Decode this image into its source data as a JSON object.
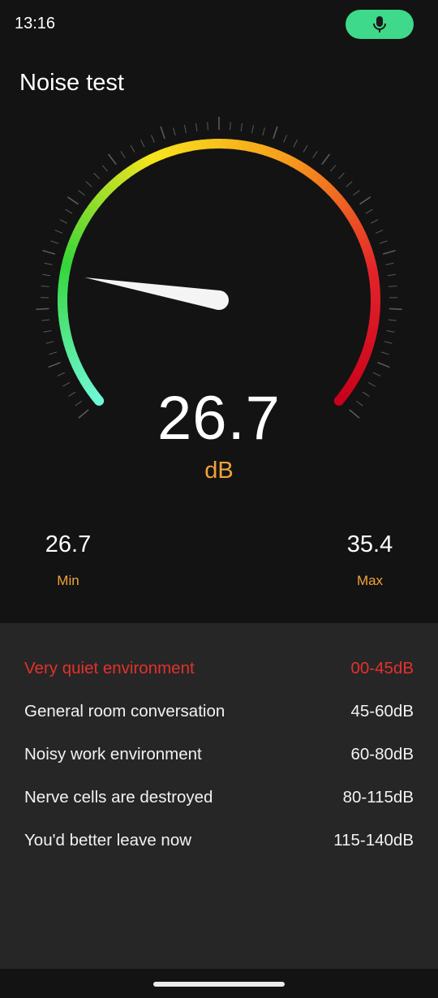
{
  "status_bar": {
    "time": "13:16",
    "mic_icon": "microphone-icon",
    "mic_pill_color": "#3ed98a"
  },
  "page": {
    "title": "Noise test"
  },
  "gauge": {
    "value": 26.7,
    "min": 0,
    "max": 140,
    "gradient_colors": [
      "#6ff7d6",
      "#35d63a",
      "#f7e51c",
      "#f79a1c",
      "#e3242a",
      "#c8001c"
    ]
  },
  "reading": {
    "value": "26.7",
    "unit": "dB"
  },
  "stats": {
    "min": {
      "value": "26.7",
      "label": "Min"
    },
    "max": {
      "value": "35.4",
      "label": "Max"
    }
  },
  "levels": [
    {
      "label": "Very quiet environment",
      "range": "00-45dB",
      "active": true
    },
    {
      "label": "General room conversation",
      "range": "45-60dB",
      "active": false
    },
    {
      "label": "Noisy work environment",
      "range": "60-80dB",
      "active": false
    },
    {
      "label": "Nerve cells are destroyed",
      "range": "80-115dB",
      "active": false
    },
    {
      "label": "You'd better leave now",
      "range": "115-140dB",
      "active": false
    }
  ],
  "colors": {
    "accent": "#f0a33a",
    "active_level": "#e3312c",
    "panel": "#262626",
    "background": "#131313"
  }
}
